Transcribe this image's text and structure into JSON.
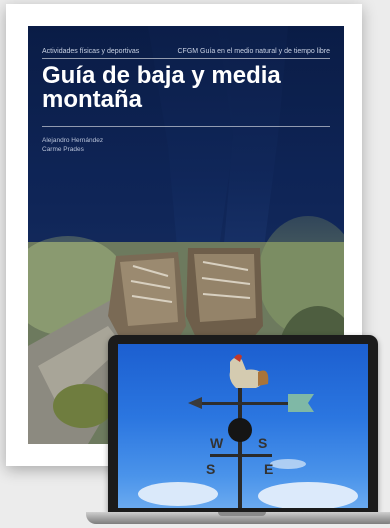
{
  "book": {
    "series_left": "Actividades físicas y deportivas",
    "series_right": "CFGM Guía en el medio natural y de tiempo libre",
    "title": "Guía de baja y media montaña",
    "authors": [
      "Alejandro Hernández",
      "Carme Prades"
    ]
  },
  "laptop": {
    "screen_content": "weathervane-with-rooster"
  },
  "colors": {
    "cover_blue": "#12285a",
    "sky_blue": "#2b76e0"
  }
}
